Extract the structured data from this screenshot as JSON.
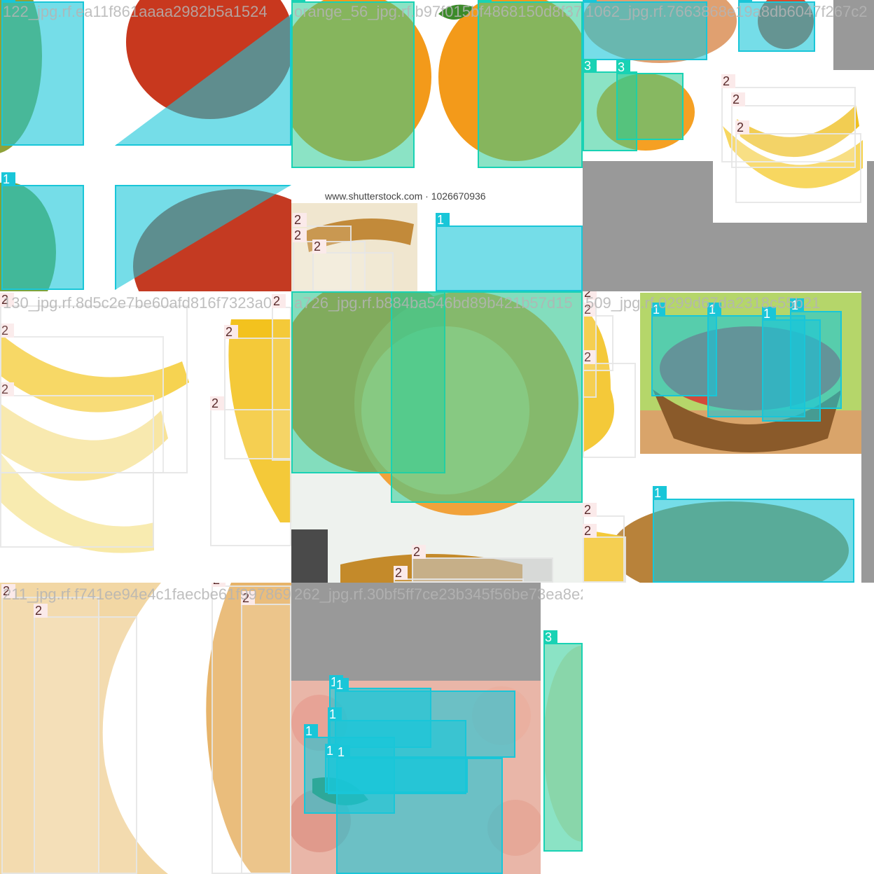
{
  "tiles": [
    {
      "name": "tile-apple-red",
      "filename": "122_jpg.rf.ea11f861aaaa2982b5a1524",
      "boxes": [
        {
          "label": "1"
        },
        {
          "label": "1"
        },
        {
          "label": "1"
        },
        {
          "label": "1"
        }
      ]
    },
    {
      "name": "tile-orange-shutterstock",
      "filename": "orange_56_jpg.rf.b97f015bf4868150d8f379dd",
      "watermark": "www.shutterstock.com · 1026670936",
      "boxes": [
        {
          "label": "3"
        },
        {
          "label": "3"
        },
        {
          "label": "1"
        },
        {
          "label": "2"
        },
        {
          "label": "2"
        },
        {
          "label": "2"
        }
      ]
    },
    {
      "name": "tile-banana-apple-small",
      "filename": "1062_jpg.rf.7663868e19a8db6047f267c2",
      "boxes": [
        {
          "label": "1"
        },
        {
          "label": "1"
        },
        {
          "label": "3"
        },
        {
          "label": "3"
        },
        {
          "label": "2"
        },
        {
          "label": "2"
        },
        {
          "label": "2"
        }
      ]
    },
    {
      "name": "tile-banana-bunch",
      "filename": "130_jpg.rf.8d5c2e7be60afd816f7323a0",
      "boxes": [
        {
          "label": "2"
        },
        {
          "label": "2"
        },
        {
          "label": "2"
        },
        {
          "label": "2"
        },
        {
          "label": "2"
        },
        {
          "label": "2"
        }
      ]
    },
    {
      "name": "tile-orange-cut",
      "filename": "a726_jpg.rf.b884ba546bd89b421b57d15",
      "boxes": [
        {
          "label": "3"
        },
        {
          "label": "3"
        },
        {
          "label": "2"
        },
        {
          "label": "2"
        }
      ]
    },
    {
      "name": "tile-apple-basket",
      "filename": "509_jpg.rf.0299d67da2318c55b21",
      "boxes": [
        {
          "label": "2"
        },
        {
          "label": "2"
        },
        {
          "label": "2"
        },
        {
          "label": "1"
        },
        {
          "label": "1"
        },
        {
          "label": "1"
        },
        {
          "label": "1"
        },
        {
          "label": "1"
        },
        {
          "label": "2"
        },
        {
          "label": "2"
        }
      ]
    },
    {
      "name": "tile-banana-closeup",
      "filename": "211_jpg.rf.f741ee94e4c1faecbe61f997869",
      "boxes": [
        {
          "label": "2"
        },
        {
          "label": "2"
        },
        {
          "label": "2"
        },
        {
          "label": "2"
        }
      ]
    },
    {
      "name": "tile-apple-pile",
      "filename": "262_jpg.rf.30bf5ff7ce23b345f56be73ea8e23",
      "boxes": [
        {
          "label": "1"
        },
        {
          "label": "1"
        },
        {
          "label": "1"
        },
        {
          "label": "1"
        },
        {
          "label": "1"
        },
        {
          "label": "1"
        },
        {
          "label": "3"
        }
      ]
    }
  ]
}
